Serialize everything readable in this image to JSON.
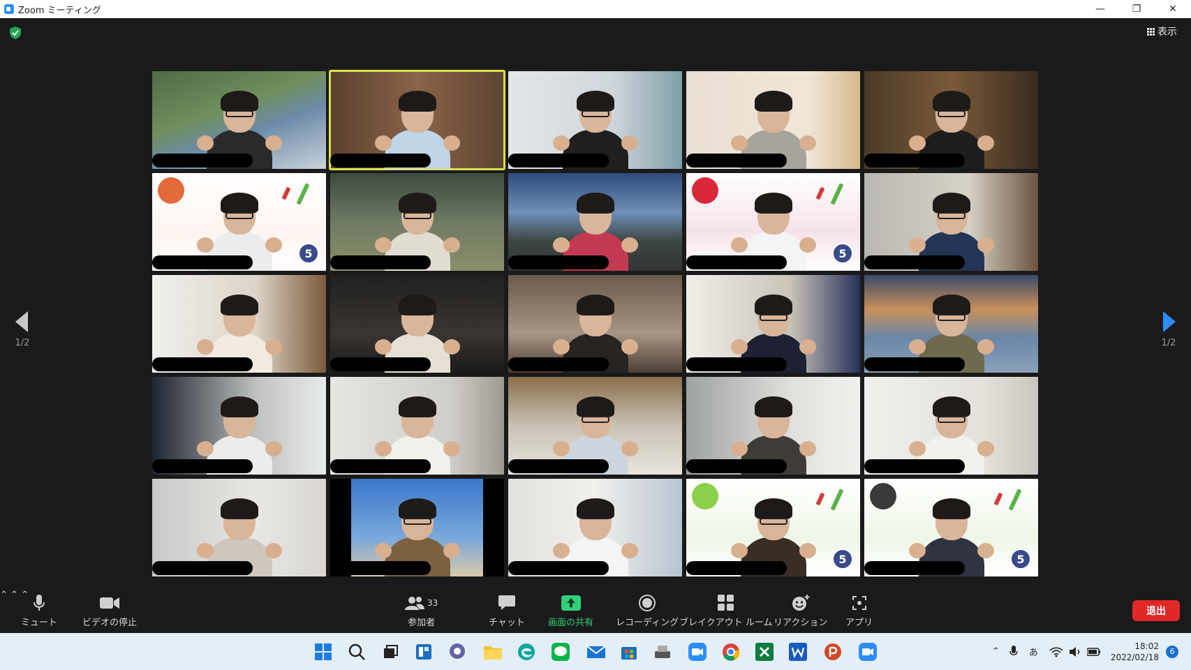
{
  "window": {
    "title": "Zoom ミーティング"
  },
  "header": {
    "view_label": "表示"
  },
  "pager": {
    "left": "1/2",
    "right": "1/2"
  },
  "participants_count": "33",
  "toolbar": {
    "mute": "ミュート",
    "video": "ビデオの停止",
    "participants": "参加者",
    "chat": "チャット",
    "share": "画面の共有",
    "record": "レコーディング",
    "breakout": "ブレイクアウト ルーム",
    "reaction": "リアクション",
    "apps": "アプリ",
    "leave": "退出"
  },
  "taskbar": {
    "time": "18:02",
    "date": "2022/02/18",
    "notifications": "6",
    "ime": "あ"
  },
  "colors": {
    "accent": "#2d8cff",
    "share_green": "#2fd07a",
    "leave_red": "#e02828",
    "speaker_frame": "#d6e34a"
  },
  "tiles": [
    {
      "bg": "linear-gradient(160deg,#4f6b45 0%,#6f8f5e 40%,#6d8aa8 60%,#c9d3dc 100%)",
      "shirt": "#2a2a2a",
      "glasses": true
    },
    {
      "bg": "linear-gradient(90deg,#5a4030,#8a6448 50%,#5d4333)",
      "shirt": "#bfd5e8",
      "glasses": false,
      "speaking": true
    },
    {
      "bg": "linear-gradient(90deg,#e3e6e8,#cfd6db 60%,#7f9fa8)",
      "shirt": "#1f1f1f",
      "glasses": true
    },
    {
      "bg": "linear-gradient(90deg,#e8dfd2,#f0e6d8 70%,#d8b98e)",
      "shirt": "#a7a49c",
      "glasses": false
    },
    {
      "bg": "linear-gradient(90deg,#4a3a28,#7a5a38 50%,#3a2c20)",
      "shirt": "#1d1d1d",
      "glasses": true
    },
    {
      "bg": "linear-gradient(180deg,#ffffff,#fff4f0 60%,#ffffff)",
      "shirt": "#ececec",
      "glasses": true,
      "sticker": "#e46a3a",
      "five": true
    },
    {
      "bg": "linear-gradient(180deg,#3c4a3f,#6f7a63 50%,#8b8f6b)",
      "shirt": "#e2ddd2",
      "glasses": true
    },
    {
      "bg": "linear-gradient(180deg,#2f4b7a,#6e8fb9 40%,#3d4641 70%,#333)",
      "shirt": "#c23a52",
      "glasses": false
    },
    {
      "bg": "linear-gradient(180deg,#ffffff,#f6e3ea 60%,#ffffff)",
      "shirt": "#f4f4f4",
      "glasses": false,
      "sticker": "#d8283a",
      "five": true
    },
    {
      "bg": "linear-gradient(90deg,#b9b7b2,#d7d2c6 60%,#6b5440)",
      "shirt": "#233455",
      "glasses": true
    },
    {
      "bg": "linear-gradient(90deg,#f0f0ee,#dcd3c6 60%,#7b5a3c)",
      "shirt": "#f2ece0",
      "glasses": false
    },
    {
      "bg": "linear-gradient(180deg,#202020,#3a3530 60%,#1a1a1a)",
      "shirt": "#e6e0d4",
      "glasses": false
    },
    {
      "bg": "linear-gradient(180deg,#6a5a4c,#a89684 60%,#4b3f35)",
      "shirt": "#262320",
      "glasses": false
    },
    {
      "bg": "linear-gradient(90deg,#f1efe8,#c9c3b9 60%,#26305a)",
      "shirt": "#1d2133",
      "glasses": true
    },
    {
      "bg": "linear-gradient(180deg,#3a4a6a,#c88f5a 35%,#6a87a8 65%,#8aa0b8)",
      "shirt": "#6e6a4d",
      "glasses": true
    },
    {
      "bg": "linear-gradient(90deg,#1e2430,#bfc2bf 60%,#e9ecec)",
      "shirt": "#ececec",
      "glasses": false
    },
    {
      "bg": "linear-gradient(90deg,#e6e5e2,#cfcdc8 70%,#9e998f)",
      "shirt": "#f2f0ea",
      "glasses": false
    },
    {
      "bg": "linear-gradient(180deg,#8a6d4c,#c9c2b4 50%,#e8e5de)",
      "shirt": "#cdd6df",
      "glasses": true
    },
    {
      "bg": "linear-gradient(90deg,#9ea2a1,#dfe0dc 60%,#f1f1ef)",
      "shirt": "#3f3b37",
      "glasses": false
    },
    {
      "bg": "linear-gradient(90deg,#f0f0ee,#e3e0da 70%,#c9c6bf)",
      "shirt": "#f3f1ec",
      "glasses": true
    },
    {
      "bg": "linear-gradient(90deg,#c8c9c7,#e8e7e4 60%,#d8d5cf)",
      "shirt": "#cfc7bd",
      "glasses": false
    },
    {
      "bg": "linear-gradient(180deg,#3b78c8,#79a8dc 60%,#d6c9aa)",
      "shirt": "#7c6040",
      "glasses": true,
      "letterbox": true
    },
    {
      "bg": "linear-gradient(90deg,#e2e1de,#f1f0ed 50%,#b9c4d1)",
      "shirt": "#f5f5f5",
      "glasses": false
    },
    {
      "bg": "linear-gradient(180deg,#ffffff,#eef6e8 60%,#ffffff)",
      "shirt": "#3a2d24",
      "glasses": true,
      "sticker": "#8bd04b",
      "five": true
    },
    {
      "bg": "linear-gradient(180deg,#ffffff,#eef6e8 60%,#ffffff)",
      "shirt": "#2f3440",
      "glasses": false,
      "sticker": "#3a3a3a",
      "five": true
    }
  ]
}
